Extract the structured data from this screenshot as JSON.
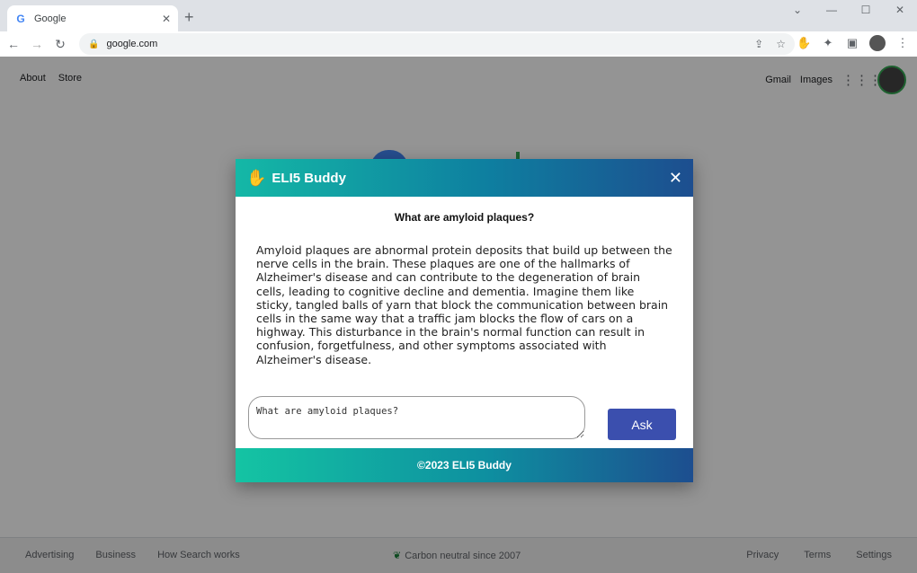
{
  "browser": {
    "tab_title": "Google",
    "tab_favicon": "G",
    "url": "google.com"
  },
  "google": {
    "nav_left": [
      "About",
      "Store"
    ],
    "nav_right": [
      "Gmail",
      "Images"
    ],
    "footer_left": [
      "Advertising",
      "Business",
      "How Search works"
    ],
    "footer_center": "Carbon neutral since 2007",
    "footer_right": [
      "Privacy",
      "Terms",
      "Settings"
    ]
  },
  "modal": {
    "title": "ELI5 Buddy",
    "question": "What are amyloid plaques?",
    "answer": "Amyloid plaques are abnormal protein deposits that build up between the nerve cells in the brain. These plaques are one of the hallmarks of Alzheimer's disease and can contribute to the degeneration of brain cells, leading to cognitive decline and dementia. Imagine them like sticky, tangled balls of yarn that block the communication between brain cells in the same way that a traffic jam blocks the flow of cars on a highway. This disturbance in the brain's normal function can result in confusion, forgetfulness, and other symptoms associated with Alzheimer's disease.",
    "input_value": "What are amyloid plaques?",
    "ask_label": "Ask",
    "footer": "©2023 ELI5 Buddy"
  },
  "colors": {
    "ask_button": "#3b4fae",
    "header_gradient_start": "#14b8a6",
    "header_gradient_end": "#1d4e8f"
  }
}
